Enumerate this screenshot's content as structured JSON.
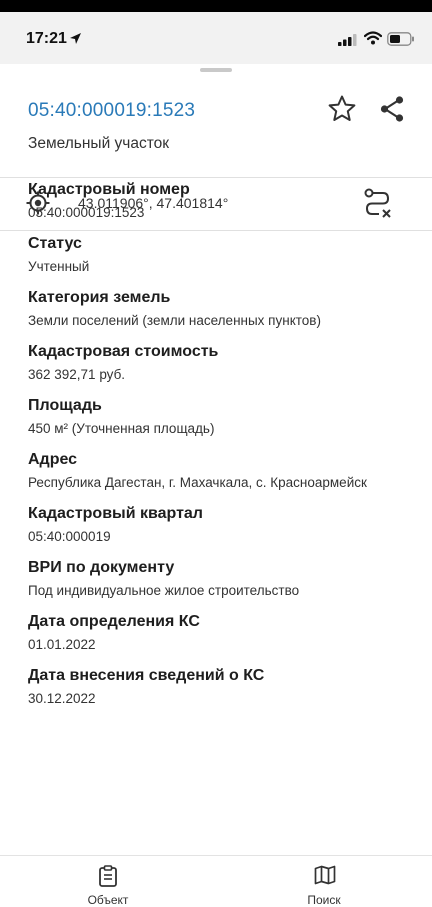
{
  "status_bar": {
    "time": "17:21"
  },
  "header": {
    "cadastral_title": "05:40:000019:1523",
    "subtitle": "Земельный участок",
    "star_icon": "star-outline-icon",
    "share_icon": "share-icon"
  },
  "coords": {
    "text": "43.011906°, 47.401814°",
    "locate_icon": "target-icon",
    "route_icon": "route-clear-icon"
  },
  "fields": [
    {
      "label": "Кадастровый номер",
      "value": "05:40:000019:1523"
    },
    {
      "label": "Статус",
      "value": "Учтенный"
    },
    {
      "label": "Категория земель",
      "value": "Земли поселений (земли населенных пунктов)"
    },
    {
      "label": "Кадастровая стоимость",
      "value": "362 392,71 руб."
    },
    {
      "label": "Площадь",
      "value": "450 м² (Уточненная площадь)"
    },
    {
      "label": "Адрес",
      "value": "Республика Дагестан, г. Махачкала, с. Красноармейск"
    },
    {
      "label": "Кадастровый квартал",
      "value": "05:40:000019"
    },
    {
      "label": "ВРИ по документу",
      "value": "Под индивидуальное жилое строительство"
    },
    {
      "label": "Дата определения КС",
      "value": "01.01.2022"
    },
    {
      "label": "Дата внесения сведений о КС",
      "value": "30.12.2022"
    }
  ],
  "bottom_tabs": [
    {
      "label": "Объект",
      "icon": "clipboard-icon"
    },
    {
      "label": "Поиск",
      "icon": "map-icon"
    }
  ],
  "colors": {
    "accent": "#2a7ab8",
    "label": "#1e1e1e",
    "value": "#333333"
  }
}
